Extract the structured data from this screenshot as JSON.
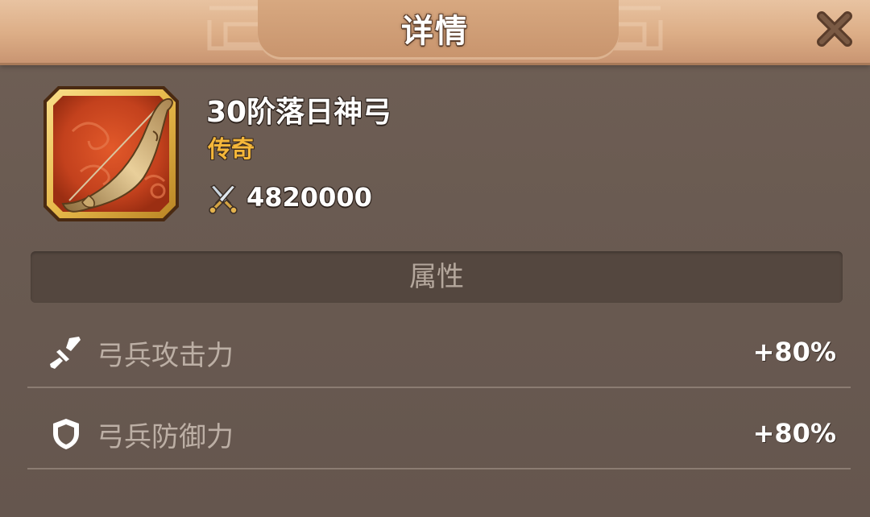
{
  "header": {
    "title": "详情",
    "close_icon": "close-icon"
  },
  "item": {
    "name": "30阶落日神弓",
    "rarity": "传奇",
    "rarity_color": "#f5b73a",
    "icon": "bow-icon",
    "power_icon": "crossed-swords-icon",
    "power_value": "4820000"
  },
  "attributes": {
    "title": "属性",
    "rows": [
      {
        "icon": "sword-icon",
        "label": "弓兵攻击力",
        "value": "+80%"
      },
      {
        "icon": "shield-icon",
        "label": "弓兵防御力",
        "value": "+80%"
      }
    ]
  },
  "colors": {
    "panel_bg": "#6a5b52",
    "header_bg": "#dcad86",
    "section_bar_bg": "#54473f",
    "item_frame_gold": "#e7b94a",
    "item_bg_red": "#c3411d"
  }
}
